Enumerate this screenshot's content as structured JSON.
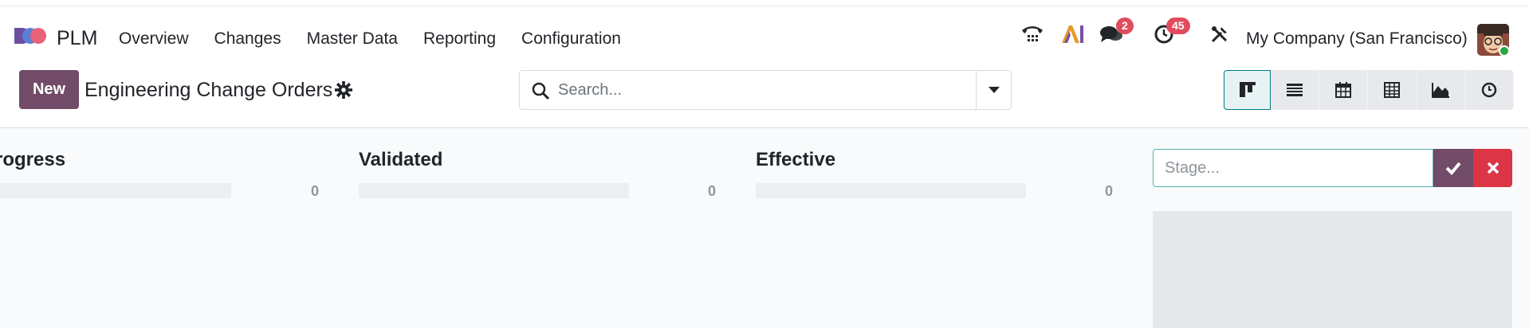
{
  "app": {
    "name": "PLM",
    "menu": [
      "Overview",
      "Changes",
      "Master Data",
      "Reporting",
      "Configuration"
    ],
    "company": "My Company (San Francisco)",
    "badges": {
      "messages": "2",
      "activities": "45"
    }
  },
  "control": {
    "new_label": "New",
    "breadcrumb": "Engineering Change Orders",
    "search_placeholder": "Search...",
    "views": [
      "kanban-view",
      "list-view",
      "calendar-view",
      "pivot-view",
      "graph-view",
      "activity-view"
    ]
  },
  "kanban": {
    "columns": [
      {
        "title": "rogress",
        "count": "0"
      },
      {
        "title": "Validated",
        "count": "0"
      },
      {
        "title": "Effective",
        "count": "0"
      }
    ],
    "quick_create_placeholder": "Stage..."
  },
  "colors": {
    "primary": "#714b67",
    "danger": "#dc3545",
    "badge": "#e04c5c",
    "accent": "#017e84"
  }
}
